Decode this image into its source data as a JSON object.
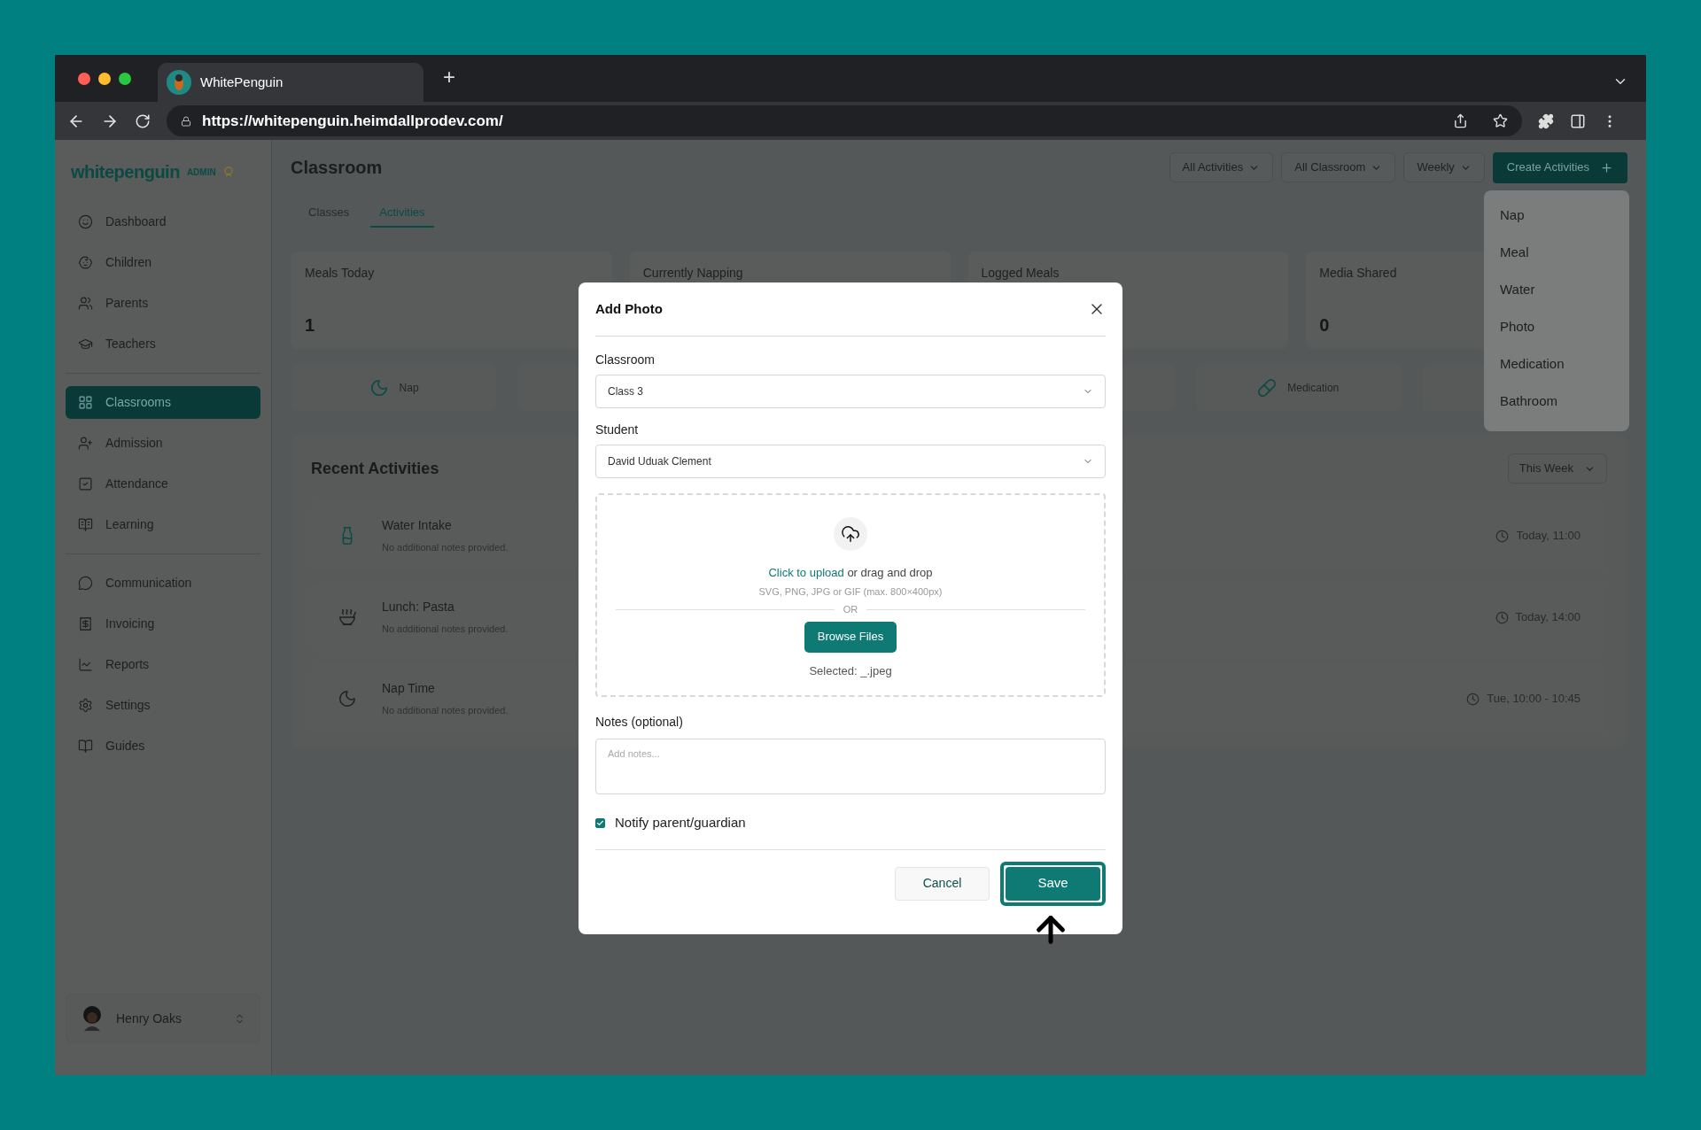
{
  "browser": {
    "tab_title": "WhitePenguin",
    "new_tab": "+",
    "url": "https://whitepenguin.heimdallprodev.com/"
  },
  "sidebar": {
    "logo": "whitepenguin",
    "badge": "ADMIN",
    "groups": [
      [
        {
          "label": "Dashboard",
          "selected": false
        },
        {
          "label": "Children",
          "selected": false
        },
        {
          "label": "Parents",
          "selected": false
        },
        {
          "label": "Teachers",
          "selected": false
        }
      ],
      [
        {
          "label": "Classrooms",
          "selected": true
        },
        {
          "label": "Admission",
          "selected": false
        },
        {
          "label": "Attendance",
          "selected": false
        },
        {
          "label": "Learning",
          "selected": false
        }
      ],
      [
        {
          "label": "Communication",
          "selected": false
        },
        {
          "label": "Invoicing",
          "selected": false
        },
        {
          "label": "Reports",
          "selected": false
        },
        {
          "label": "Settings",
          "selected": false
        },
        {
          "label": "Guides",
          "selected": false
        }
      ]
    ],
    "user": {
      "name": "Henry Oaks"
    }
  },
  "page": {
    "title": "Classroom",
    "filters": [
      "All Activities",
      "All Classroom",
      "Weekly"
    ],
    "create_button": "Create Activities",
    "tabs": [
      {
        "label": "Classes",
        "selected": false
      },
      {
        "label": "Activities",
        "selected": true
      }
    ],
    "stats": [
      {
        "label": "Meals Today",
        "value": "1"
      },
      {
        "label": "Currently Napping"
      },
      {
        "label": "Logged Meals"
      },
      {
        "label": "Media Shared",
        "value": "0"
      }
    ],
    "quick_actions": [
      {
        "kind": "nap",
        "label": "Nap"
      },
      {
        "kind": "hidden"
      },
      {
        "kind": "hidden"
      },
      {
        "kind": "medication",
        "label": "Medication"
      },
      {
        "kind": "hidden"
      }
    ],
    "recent": {
      "title": "Recent Activities",
      "period": "This Week",
      "items": [
        {
          "kind": "water",
          "title": "Water Intake",
          "note": "No additional notes provided.",
          "time": "Today, 11:00"
        },
        {
          "kind": "meal",
          "title": "Lunch: Pasta",
          "note": "No additional notes provided.",
          "time": "Today, 14:00"
        },
        {
          "kind": "nap",
          "title": "Nap Time",
          "note": "No additional notes provided.",
          "time": "Tue, 10:00 - 10:45"
        }
      ]
    }
  },
  "create_menu": {
    "expanded": true,
    "items": [
      "Nap",
      "Meal",
      "Water",
      "Photo",
      "Medication",
      "Bathroom"
    ]
  },
  "modal": {
    "title": "Add Photo",
    "classroom": {
      "label": "Classroom",
      "value": "Class 3"
    },
    "student": {
      "label": "Student",
      "value": "David Uduak Clement"
    },
    "upload": {
      "link": "Click to upload",
      "text": "or drag and drop",
      "hint": "SVG, PNG, JPG or GIF (max. 800×400px)",
      "or": "OR",
      "button": "Browse Files",
      "selected": "Selected: _.jpeg"
    },
    "notes": {
      "label": "Notes (optional)",
      "placeholder": "Add notes..."
    },
    "notify": {
      "label": "Notify parent/guardian",
      "checked": true
    },
    "cancel": "Cancel",
    "save": "Save",
    "save_highlighted": true
  }
}
